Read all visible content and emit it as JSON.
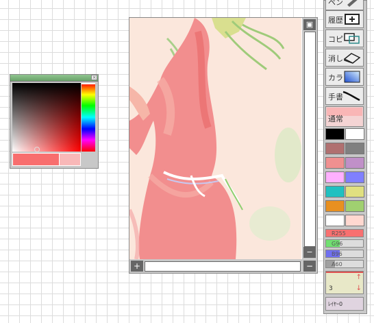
{
  "picker": {
    "close_glyph": "×",
    "current_color": "#f86e6e",
    "previous_color": "#f9b8b8"
  },
  "canvas": {
    "scroll_top_glyph": "▣",
    "scroll_bottom_glyph": "−",
    "zoom_in_glyph": "+",
    "zoom_out_glyph": "−"
  },
  "tools": {
    "pen_label": "ペン",
    "history_label": "履歴",
    "copy_label": "コピ",
    "eraser_label": "消し",
    "color_label": "カラ",
    "handwrite_label": "手書",
    "blend_mode": "通常",
    "swatches": [
      "#000000",
      "#ffffff",
      "#b07070",
      "#808080",
      "#f09090",
      "#c090c8",
      "#ffb0ff",
      "#8080ff",
      "#20c0c0",
      "#e0e080",
      "#e89020",
      "#a0d070",
      "#ffffff",
      "#ffd8d0"
    ],
    "rgba": {
      "r_label": "R255",
      "g_label": "G96",
      "b_label": "B96",
      "a_label": "A60",
      "r": 255,
      "g": 96,
      "b": 96,
      "a": 60
    },
    "brush_size": "3",
    "layer_label": "ﾚｲﾔｰ0"
  }
}
